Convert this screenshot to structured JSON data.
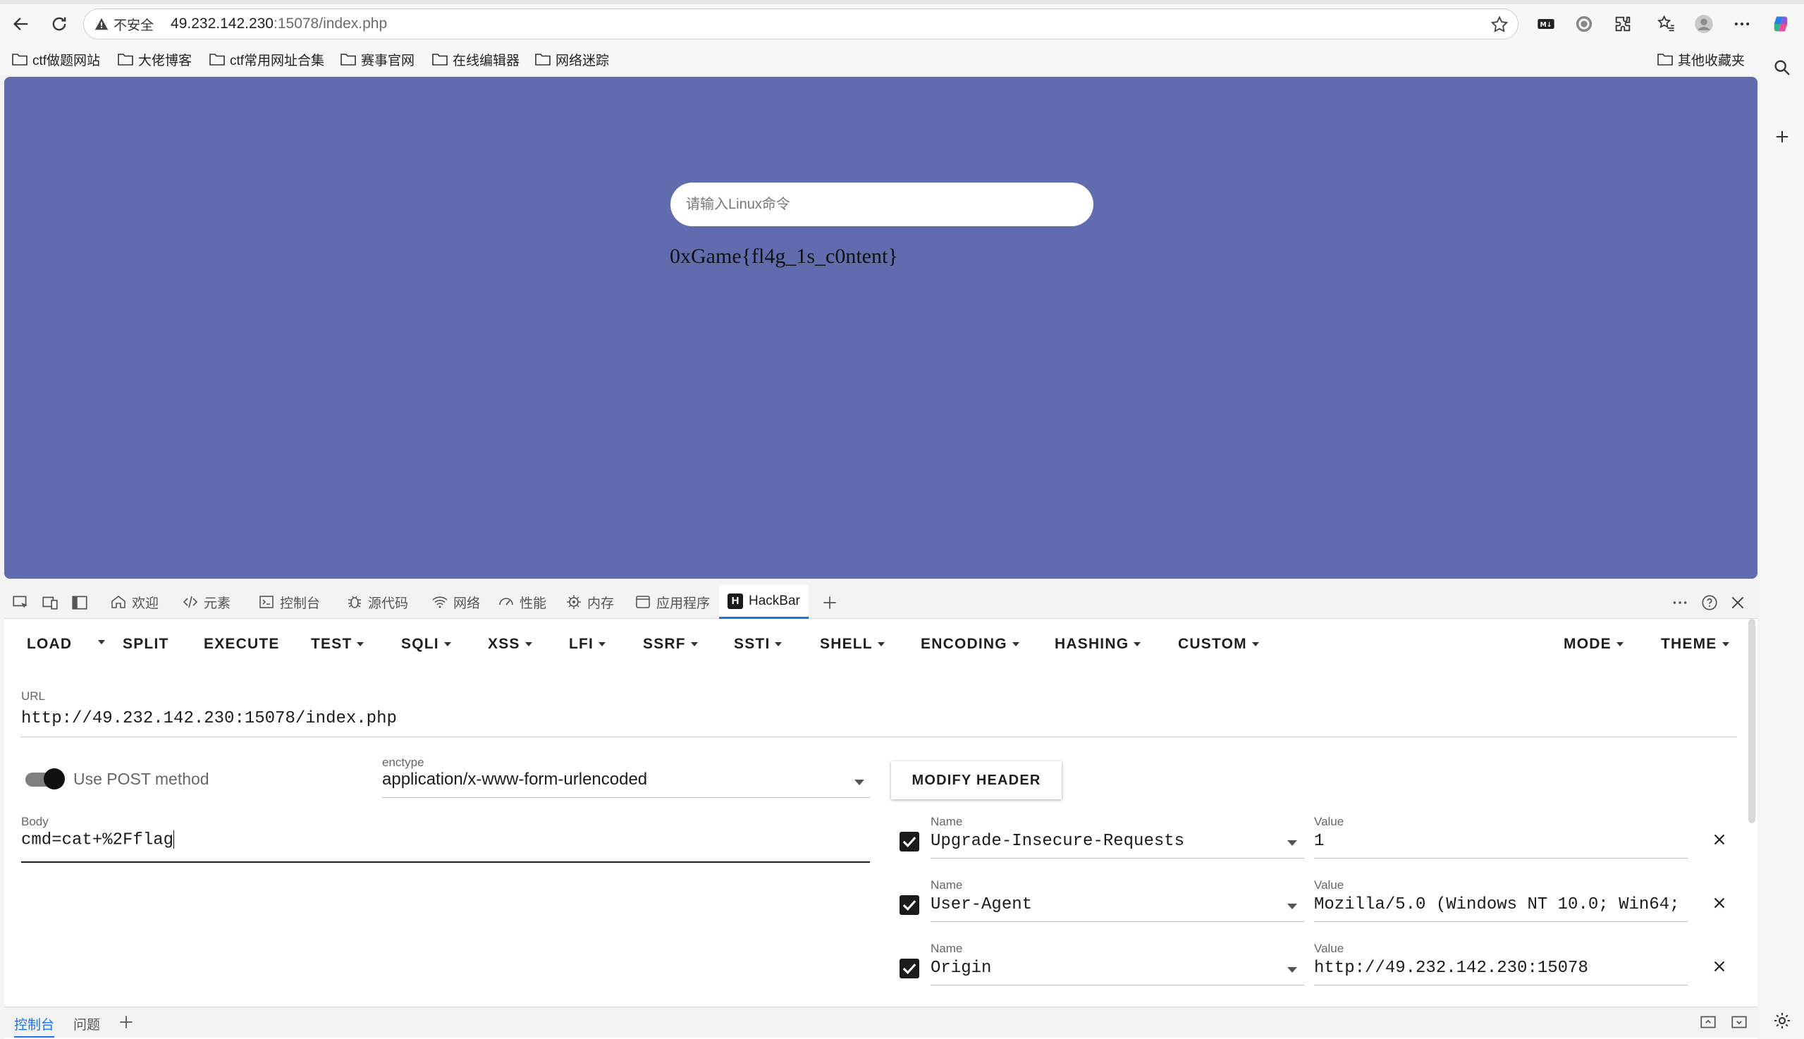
{
  "browser": {
    "insecure_label": "不安全",
    "url_host": "49.232.142.230",
    "url_path": ":15078/index.php"
  },
  "bookmarks": [
    {
      "label": "ctf做题网站"
    },
    {
      "label": "大佬博客"
    },
    {
      "label": "ctf常用网址合集"
    },
    {
      "label": "赛事官网"
    },
    {
      "label": "在线编辑器"
    },
    {
      "label": "网络迷踪"
    }
  ],
  "other_bookmarks": "其他收藏夹",
  "page": {
    "input_placeholder": "请输入Linux命令",
    "output": "0xGame{fl4g_1s_c0ntent}"
  },
  "devtools": {
    "tabs": [
      {
        "label": "欢迎",
        "icon": "home-icon"
      },
      {
        "label": "元素",
        "icon": "code-icon"
      },
      {
        "label": "控制台",
        "icon": "console-icon"
      },
      {
        "label": "源代码",
        "icon": "bug-icon"
      },
      {
        "label": "网络",
        "icon": "wifi-icon"
      },
      {
        "label": "性能",
        "icon": "gauge-icon"
      },
      {
        "label": "内存",
        "icon": "cpu-icon"
      },
      {
        "label": "应用程序",
        "icon": "window-icon"
      }
    ],
    "active_tab": "HackBar",
    "drawer_tabs": [
      "控制台",
      "问题"
    ]
  },
  "hackbar": {
    "menu": {
      "load": "LOAD",
      "split": "SPLIT",
      "execute": "EXECUTE",
      "test": "TEST",
      "sqli": "SQLI",
      "xss": "XSS",
      "lfi": "LFI",
      "ssrf": "SSRF",
      "ssti": "SSTI",
      "shell": "SHELL",
      "encoding": "ENCODING",
      "hashing": "HASHING",
      "custom": "CUSTOM",
      "mode": "MODE",
      "theme": "THEME"
    },
    "url_label": "URL",
    "url_value": "http://49.232.142.230:15078/index.php",
    "post_label": "Use POST method",
    "post_enabled": true,
    "enctype_label": "enctype",
    "enctype_value": "application/x-www-form-urlencoded",
    "modify_header_label": "MODIFY HEADER",
    "body_label": "Body",
    "body_value": "cmd=cat+%2Fflag",
    "name_label": "Name",
    "value_label": "Value",
    "headers": [
      {
        "name": "Upgrade-Insecure-Requests",
        "value": "1",
        "checked": true
      },
      {
        "name": "User-Agent",
        "value": "Mozilla/5.0 (Windows NT 10.0; Win64;",
        "checked": true
      },
      {
        "name": "Origin",
        "value": "http://49.232.142.230:15078",
        "checked": true
      }
    ]
  }
}
